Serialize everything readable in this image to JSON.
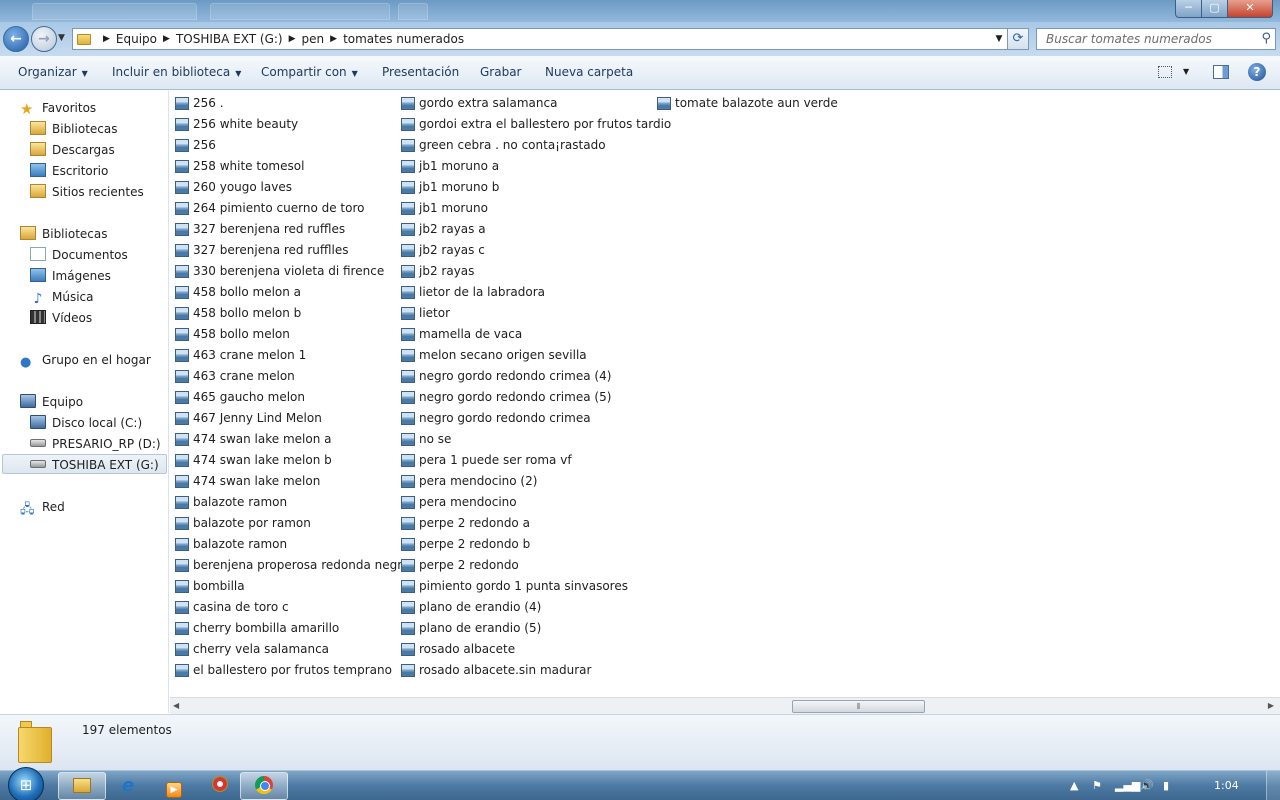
{
  "window": {
    "minimize": "─",
    "maximize": "▢",
    "close": "✕"
  },
  "address": {
    "crumbs": [
      "Equipo",
      "TOSHIBA EXT (G:)",
      "pen",
      "tomates numerados"
    ],
    "search_placeholder": "Buscar tomates numerados"
  },
  "toolbar": {
    "organize": "Organizar",
    "include_library": "Incluir en biblioteca",
    "share_with": "Compartir con",
    "slideshow": "Presentación",
    "burn": "Grabar",
    "new_folder": "Nueva carpeta"
  },
  "nav": {
    "favorites": "Favoritos",
    "fav_items": [
      "Bibliotecas",
      "Descargas",
      "Escritorio",
      "Sitios recientes"
    ],
    "libraries": "Bibliotecas",
    "lib_items": [
      "Documentos",
      "Imágenes",
      "Música",
      "Vídeos"
    ],
    "homegroup": "Grupo en el hogar",
    "computer": "Equipo",
    "drives": [
      "Disco local (C:)",
      "PRESARIO_RP (D:)",
      "TOSHIBA EXT (G:)"
    ],
    "network": "Red"
  },
  "files": {
    "col1": [
      "256 .",
      "256 white beauty",
      "256",
      "258 white tomesol",
      "260 yougo laves",
      "264 pimiento cuerno de toro",
      "327 berenjena red ruffles",
      "327 berenjena red rufflles",
      "330 berenjena violeta di firence",
      "458 bollo melon a",
      "458 bollo melon b",
      "458 bollo melon",
      "463 crane melon 1",
      "463 crane melon",
      "465 gaucho melon",
      "467 Jenny Lind Melon",
      "474 swan lake melon a",
      "474 swan lake melon b",
      "474 swan lake melon",
      "balazote  ramon",
      "balazote por ramon",
      "balazote ramon",
      "berenjena properosa redonda negra",
      "bombilla",
      "casina de toro c",
      "cherry bombilla amarillo",
      "cherry vela salamanca",
      "el ballestero por frutos temprano"
    ],
    "col2": [
      "gordo extra salamanca",
      "gordoi extra el ballestero por frutos tardio",
      "green cebra . no conta¡rastado",
      "jb1 moruno a",
      "jb1 moruno b",
      "jb1 moruno",
      "jb2 rayas a",
      "jb2 rayas c",
      "jb2 rayas",
      "lietor de la labradora",
      "lietor",
      "mamella de vaca",
      "melon secano origen sevilla",
      "negro gordo redondo crimea (4)",
      "negro gordo redondo crimea (5)",
      "negro gordo redondo crimea",
      "no se",
      "pera 1 puede ser roma vf",
      "pera mendocino (2)",
      "pera mendocino",
      "perpe 2 redondo a",
      "perpe 2 redondo b",
      "perpe 2 redondo",
      "pimiento gordo 1 punta sinvasores",
      "plano de erandio (4)",
      "plano de erandio (5)",
      "rosado albacete",
      "rosado albacete.sin madurar"
    ],
    "col3": [
      "tomate balazote aun verde"
    ]
  },
  "status": {
    "count": "197 elementos"
  },
  "taskbar": {
    "clock": "1:04"
  }
}
